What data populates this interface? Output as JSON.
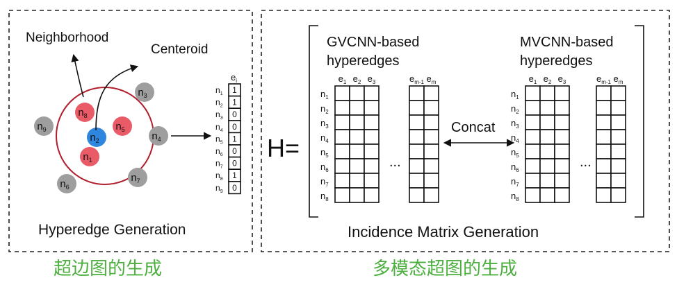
{
  "left_panel": {
    "title": "Hyperedge Generation",
    "caption": "超边图的生成",
    "arrow_labels": {
      "neighborhood": "Neighborhood",
      "centeroid": "Centeroid"
    },
    "nodes": [
      {
        "label": "n",
        "sub": "1",
        "color": "#ea5b68"
      },
      {
        "label": "n",
        "sub": "2",
        "color": "#2e86de"
      },
      {
        "label": "n",
        "sub": "3",
        "color": "#9e9e9e"
      },
      {
        "label": "n",
        "sub": "4",
        "color": "#9e9e9e"
      },
      {
        "label": "n",
        "sub": "5",
        "color": "#ea5b68"
      },
      {
        "label": "n",
        "sub": "6",
        "color": "#9e9e9e"
      },
      {
        "label": "n",
        "sub": "7",
        "color": "#9e9e9e"
      },
      {
        "label": "n",
        "sub": "8",
        "color": "#ea5b68"
      },
      {
        "label": "n",
        "sub": "9",
        "color": "#9e9e9e"
      }
    ],
    "ring_color": "#b01e2c",
    "vector": {
      "header": {
        "label": "e",
        "sub": "i"
      },
      "rows": [
        {
          "label": "n",
          "sub": "1",
          "value": "1"
        },
        {
          "label": "n",
          "sub": "2",
          "value": "1"
        },
        {
          "label": "n",
          "sub": "3",
          "value": "0"
        },
        {
          "label": "n",
          "sub": "4",
          "value": "0"
        },
        {
          "label": "n",
          "sub": "5",
          "value": "1"
        },
        {
          "label": "n",
          "sub": "6",
          "value": "0"
        },
        {
          "label": "n",
          "sub": "7",
          "value": "0"
        },
        {
          "label": "n",
          "sub": "8",
          "value": "1"
        },
        {
          "label": "n",
          "sub": "9",
          "value": "0"
        }
      ]
    }
  },
  "right_panel": {
    "title": "Incidence Matrix Generation",
    "caption": "多模态超图的生成",
    "h_label": "H=",
    "concat_label": "Concat",
    "ellipsis": "...",
    "row_labels": [
      {
        "label": "n",
        "sub": "1"
      },
      {
        "label": "n",
        "sub": "2"
      },
      {
        "label": "n",
        "sub": "3"
      },
      {
        "label": "n",
        "sub": "4"
      },
      {
        "label": "n",
        "sub": "5"
      },
      {
        "label": "n",
        "sub": "6"
      },
      {
        "label": "n",
        "sub": "7"
      },
      {
        "label": "n",
        "sub": "8"
      }
    ],
    "blocks": [
      {
        "title_lines": [
          "GVCNN-based",
          "hyperedges"
        ],
        "left_cols": [
          {
            "label": "e",
            "sub": "1"
          },
          {
            "label": "e",
            "sub": "2"
          },
          {
            "label": "e",
            "sub": "3"
          }
        ],
        "right_cols": [
          {
            "label": "e",
            "sub": "m-1"
          },
          {
            "label": "e",
            "sub": "m"
          }
        ]
      },
      {
        "title_lines": [
          "MVCNN-based",
          "hyperedges"
        ],
        "left_cols": [
          {
            "label": "e",
            "sub": "1"
          },
          {
            "label": "e",
            "sub": "2"
          },
          {
            "label": "e",
            "sub": "3"
          }
        ],
        "right_cols": [
          {
            "label": "e",
            "sub": "m-1"
          },
          {
            "label": "e",
            "sub": "m"
          }
        ]
      }
    ]
  }
}
